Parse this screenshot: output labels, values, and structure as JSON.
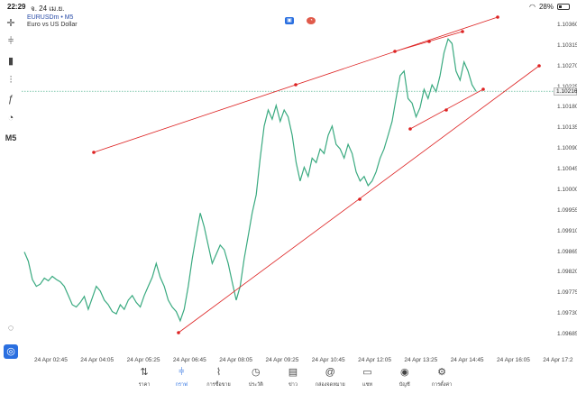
{
  "status_bar": {
    "time": "22:29",
    "date": "จ. 24 เม.ย.",
    "battery": "28%"
  },
  "chart": {
    "symbol": "EURUSDm • M5",
    "description": "Euro vs US Dollar",
    "timeframe": "M5",
    "current_price": "1.10216",
    "price_scale": [
      "1.10360",
      "1.10315",
      "1.10270",
      "1.10225",
      "1.10180",
      "1.10135",
      "1.10090",
      "1.10045",
      "1.10000",
      "1.09955",
      "1.09910",
      "1.09865",
      "1.09820",
      "1.09775",
      "1.09730",
      "1.09685"
    ],
    "time_scale": [
      "24 Apr 02:45",
      "24 Apr 04:05",
      "24 Apr 05:25",
      "24 Apr 06:45",
      "24 Apr 08:05",
      "24 Apr 09:25",
      "24 Apr 10:45",
      "24 Apr 12:05",
      "24 Apr 13:25",
      "24 Apr 14:45",
      "24 Apr 16:05",
      "24 Apr 17:2"
    ],
    "line_color": "#3aaa80",
    "trendline_color": "#dd2222",
    "price_series": [
      1.09865,
      1.09845,
      1.09805,
      1.0979,
      1.09795,
      1.09808,
      1.09802,
      1.09812,
      1.09805,
      1.098,
      1.0979,
      1.0977,
      1.0975,
      1.09745,
      1.09755,
      1.09768,
      1.0974,
      1.09765,
      1.0979,
      1.0978,
      1.0976,
      1.0975,
      1.09735,
      1.0973,
      1.0975,
      1.0974,
      1.0976,
      1.0977,
      1.09755,
      1.09745,
      1.0977,
      1.0979,
      1.0981,
      1.0984,
      1.0981,
      1.0979,
      1.0976,
      1.09745,
      1.09735,
      1.09715,
      1.0974,
      1.0979,
      1.0985,
      1.099,
      1.0995,
      1.0992,
      1.0988,
      1.0984,
      1.0986,
      1.0988,
      1.0987,
      1.0984,
      1.098,
      1.0976,
      1.0979,
      1.0985,
      1.099,
      1.0995,
      1.0999,
      1.1007,
      1.1014,
      1.10175,
      1.10155,
      1.10185,
      1.1015,
      1.10175,
      1.1016,
      1.1012,
      1.1006,
      1.1002,
      1.1005,
      1.1003,
      1.1007,
      1.1006,
      1.1009,
      1.1008,
      1.1012,
      1.1014,
      1.101,
      1.1009,
      1.1007,
      1.101,
      1.1008,
      1.1004,
      1.1002,
      1.1003,
      1.1001,
      1.1002,
      1.1004,
      1.1007,
      1.1009,
      1.1012,
      1.1015,
      1.102,
      1.1025,
      1.1026,
      1.102,
      1.1019,
      1.1016,
      1.1018,
      1.1022,
      1.102,
      1.1023,
      1.10215,
      1.1025,
      1.103,
      1.1033,
      1.1032,
      1.1026,
      1.1024,
      1.1028,
      1.1026,
      1.1023,
      1.10216
    ]
  },
  "toolbar": [
    {
      "name": "crosshair-icon",
      "glyph": "✛"
    },
    {
      "name": "candles-icon",
      "glyph": "⫩"
    },
    {
      "name": "bars-icon",
      "glyph": "▮"
    },
    {
      "name": "indicators-icon",
      "glyph": "⫶"
    },
    {
      "name": "function-icon",
      "glyph": "ƒ"
    },
    {
      "name": "objects-icon",
      "glyph": "◔"
    },
    {
      "name": "timeframe-icon",
      "glyph": "M5"
    }
  ],
  "bottom_nav": [
    {
      "name": "nav-quotes",
      "label": "ราคา",
      "icon": "⇅",
      "active": false
    },
    {
      "name": "nav-chart",
      "label": "กราฟ",
      "icon": "⫩",
      "active": true
    },
    {
      "name": "nav-trade",
      "label": "การซื้อขาย",
      "icon": "⌇",
      "active": false
    },
    {
      "name": "nav-history",
      "label": "ประวัติ",
      "icon": "◷",
      "active": false
    },
    {
      "name": "nav-news",
      "label": "ข่าว",
      "icon": "▤",
      "active": false
    },
    {
      "name": "nav-mailbox",
      "label": "กล่องจดหมาย",
      "icon": "@",
      "active": false
    },
    {
      "name": "nav-chat",
      "label": "แชท",
      "icon": "▭",
      "active": false
    },
    {
      "name": "nav-accounts",
      "label": "บัญชี",
      "icon": "◉",
      "active": false
    },
    {
      "name": "nav-settings",
      "label": "การตั้งค่า",
      "icon": "⚙",
      "active": false
    }
  ]
}
